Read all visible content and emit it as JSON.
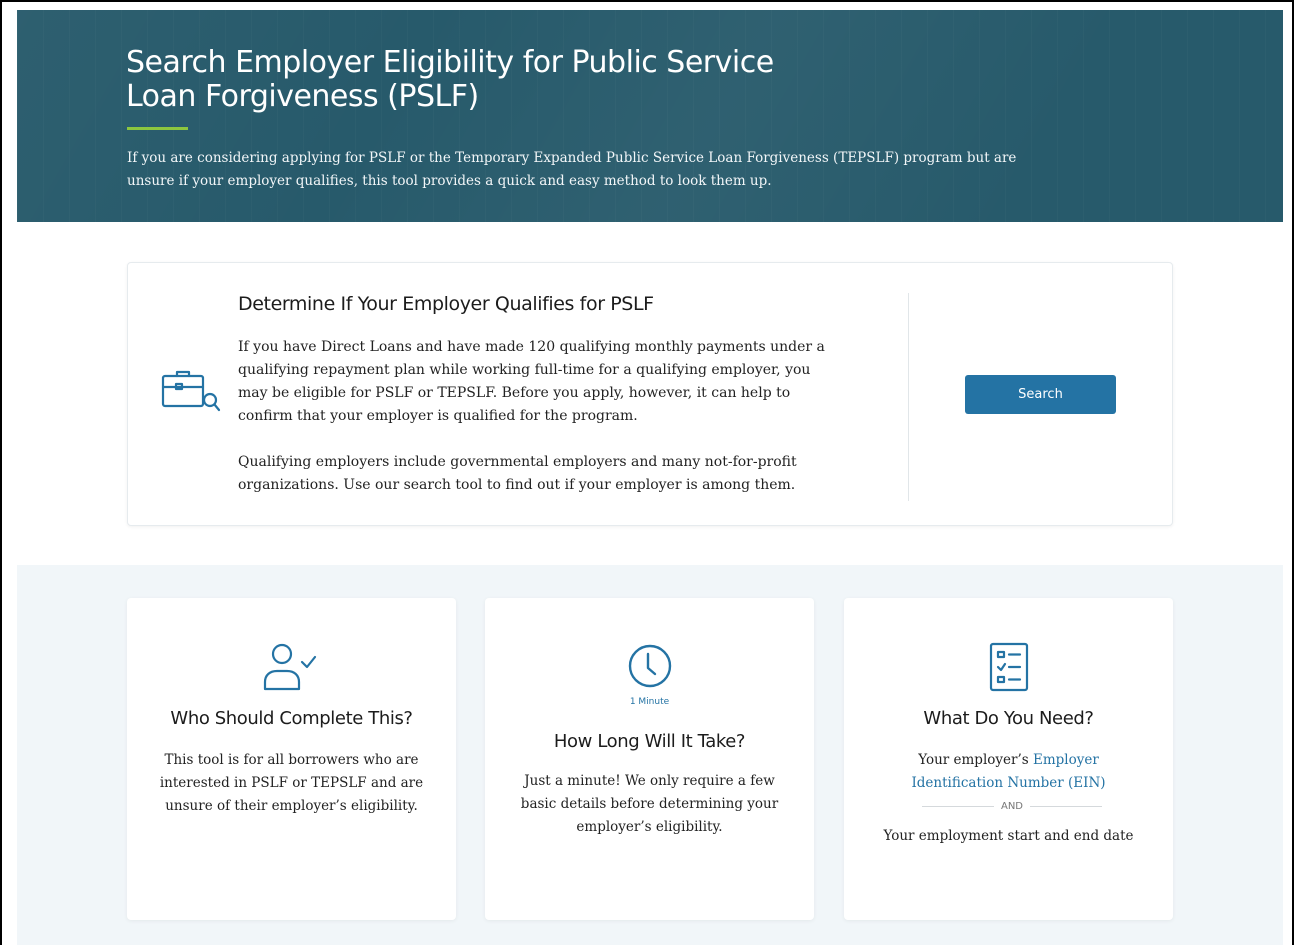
{
  "hero": {
    "title": "Search Employer Eligibility for Public Service Loan Forgiveness (PSLF)",
    "description": "If you are considering applying for PSLF or the Temporary Expanded Public Service Loan Forgiveness (TEPSLF) program but are unsure if your employer qualifies, this tool provides a quick and easy method to look them up."
  },
  "main_card": {
    "icon": "briefcase-search-icon",
    "title": "Determine If Your Employer Qualifies for PSLF",
    "paragraph_1": "If you have Direct Loans and have made 120 qualifying monthly payments under a qualifying repayment plan while working full-time for a qualifying employer, you may be eligible for PSLF or TEPSLF. Before you apply, however, it can help to confirm that your employer is qualified for the program.",
    "paragraph_2": "Qualifying employers include governmental employers and many not-for-profit organizations. Use our search tool to find out if your employer is among them.",
    "search_label": "Search"
  },
  "info_cards": [
    {
      "icon": "person-check-icon",
      "title": "Who Should Complete This?",
      "text": "This tool is for all borrowers who are interested in PSLF or TEPSLF and are unsure of their employer’s eligibility."
    },
    {
      "icon": "clock-icon",
      "icon_label": "1 Minute",
      "title": "How Long Will It Take?",
      "text": "Just a minute! We only require a few basic details before determining your employer’s eligibility."
    },
    {
      "icon": "checklist-icon",
      "title": "What Do You Need?",
      "text_prefix": "Your employer’s",
      "link_text": "Employer Identification Number (EIN)",
      "separator": "AND",
      "text_2": "Your employment start and end date"
    }
  ],
  "colors": {
    "hero_bg": "#275a6b",
    "accent_green": "#8cc63f",
    "primary_blue": "#2473a4",
    "band_bg": "#f1f6f9"
  }
}
